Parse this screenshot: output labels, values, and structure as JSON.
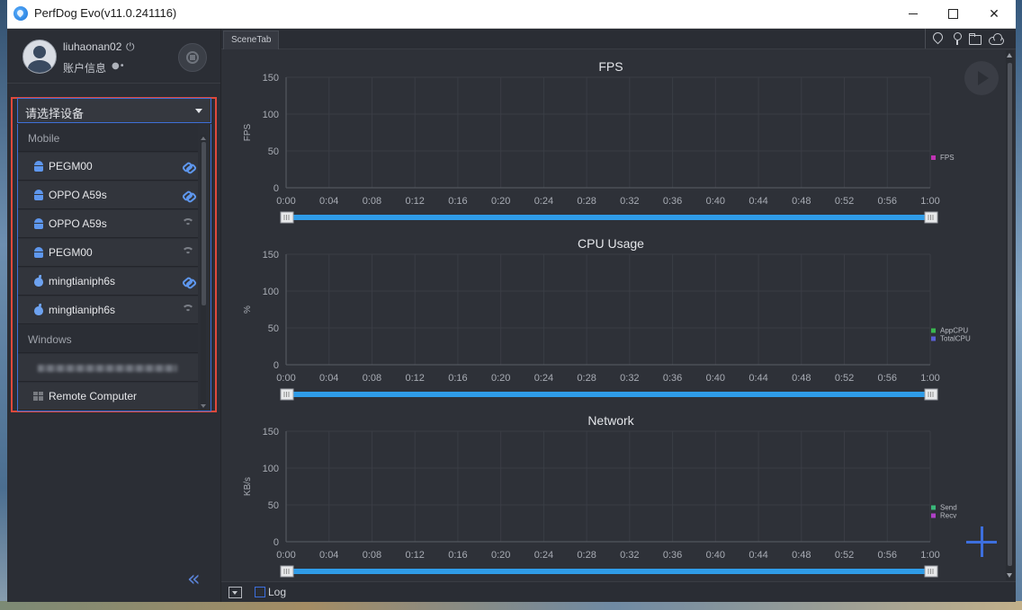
{
  "window": {
    "title": "PerfDog Evo(v11.0.241116)"
  },
  "user": {
    "name": "liuhaonan02",
    "account_label": "账户信息"
  },
  "device_selector": {
    "placeholder": "请选择设备",
    "groups": [
      {
        "label": "Mobile"
      },
      {
        "label": "Windows"
      }
    ],
    "items": [
      {
        "label": "PEGM00",
        "os": "android-icon",
        "connection": "usb-link-icon"
      },
      {
        "label": "OPPO A59s",
        "os": "android-icon",
        "connection": "usb-link-icon"
      },
      {
        "label": "OPPO A59s",
        "os": "android-icon",
        "connection": "wifi-icon"
      },
      {
        "label": "PEGM00",
        "os": "android-icon",
        "connection": "wifi-icon"
      },
      {
        "label": "mingtianiph6s",
        "os": "apple-icon",
        "connection": "usb-link-icon"
      },
      {
        "label": "mingtianiph6s",
        "os": "apple-icon",
        "connection": "wifi-icon"
      }
    ],
    "windows_items": [
      {
        "label": "",
        "os": "windows-icon",
        "note": "blurred"
      },
      {
        "label": "Remote Computer",
        "os": "windows-icon"
      }
    ]
  },
  "tabs": {
    "scene_tab": "SceneTab"
  },
  "bottom": {
    "log_label": "Log"
  },
  "colors": {
    "accent": "#3d6fde",
    "highlight_frame": "#e0493c",
    "fps": "#c034b4",
    "app_cpu": "#3ab84f",
    "total_cpu": "#5a5fd6",
    "send": "#3ab87a",
    "recv": "#b040c8",
    "time_slider": "#2f9ce8"
  },
  "chart_data": [
    {
      "type": "line",
      "title": "FPS",
      "ylabel": "FPS",
      "ylim": [
        0,
        150
      ],
      "yticks": [
        "0",
        "50",
        "100",
        "150"
      ],
      "x": [
        "0:00",
        "0:04",
        "0:08",
        "0:12",
        "0:16",
        "0:20",
        "0:24",
        "0:28",
        "0:32",
        "0:36",
        "0:40",
        "0:44",
        "0:48",
        "0:52",
        "0:56",
        "1:00"
      ],
      "series": [
        {
          "name": "FPS",
          "values": []
        }
      ],
      "legend": "right",
      "grid": true
    },
    {
      "type": "line",
      "title": "CPU Usage",
      "ylabel": "%",
      "ylim": [
        0,
        150
      ],
      "yticks": [
        "0",
        "50",
        "100",
        "150"
      ],
      "x": [
        "0:00",
        "0:04",
        "0:08",
        "0:12",
        "0:16",
        "0:20",
        "0:24",
        "0:28",
        "0:32",
        "0:36",
        "0:40",
        "0:44",
        "0:48",
        "0:52",
        "0:56",
        "1:00"
      ],
      "series": [
        {
          "name": "AppCPU",
          "values": []
        },
        {
          "name": "TotalCPU",
          "values": []
        }
      ],
      "legend": "right",
      "grid": true
    },
    {
      "type": "line",
      "title": "Network",
      "ylabel": "KB/s",
      "ylim": [
        0,
        150
      ],
      "yticks": [
        "0",
        "50",
        "100",
        "150"
      ],
      "x": [
        "0:00",
        "0:04",
        "0:08",
        "0:12",
        "0:16",
        "0:20",
        "0:24",
        "0:28",
        "0:32",
        "0:36",
        "0:40",
        "0:44",
        "0:48",
        "0:52",
        "0:56",
        "1:00"
      ],
      "series": [
        {
          "name": "Send",
          "values": []
        },
        {
          "name": "Recv",
          "values": []
        }
      ],
      "legend": "right",
      "grid": true
    }
  ]
}
